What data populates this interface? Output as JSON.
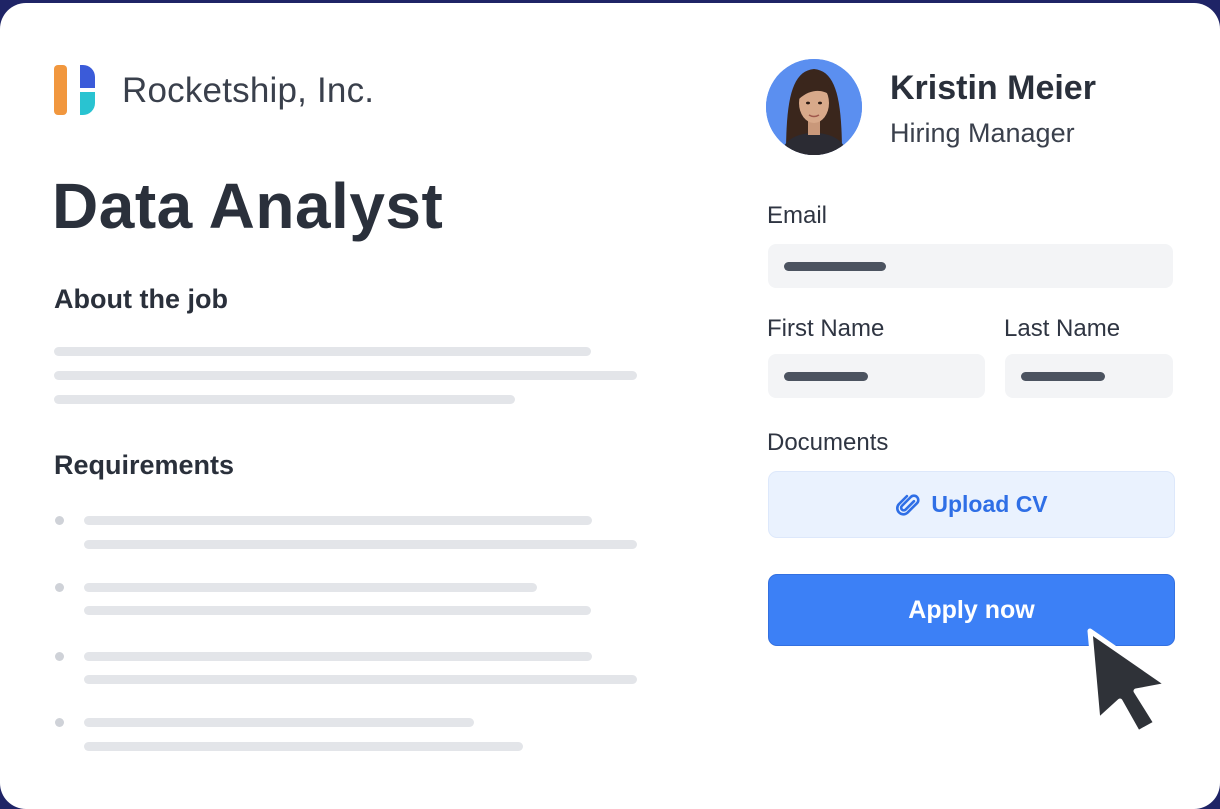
{
  "company": {
    "name": "Rocketship, Inc.",
    "logo": "rocketship-logo"
  },
  "job": {
    "title": "Data Analyst"
  },
  "sections": {
    "about": "About the job",
    "requirements": "Requirements"
  },
  "contact": {
    "name": "Kristin Meier",
    "role": "Hiring Manager",
    "avatar": "hiring-manager-photo"
  },
  "form": {
    "email_label": "Email",
    "first_name_label": "First Name",
    "last_name_label": "Last Name",
    "documents_label": "Documents",
    "upload_label": "Upload CV",
    "apply_label": "Apply now"
  },
  "icons": {
    "upload": "paperclip-icon",
    "pointer": "mouse-cursor-icon"
  },
  "colors": {
    "accent": "#3c80f6",
    "upload_bg": "#eaf2fe",
    "upload_text": "#2f6fe6",
    "frame": "#1f2466"
  }
}
